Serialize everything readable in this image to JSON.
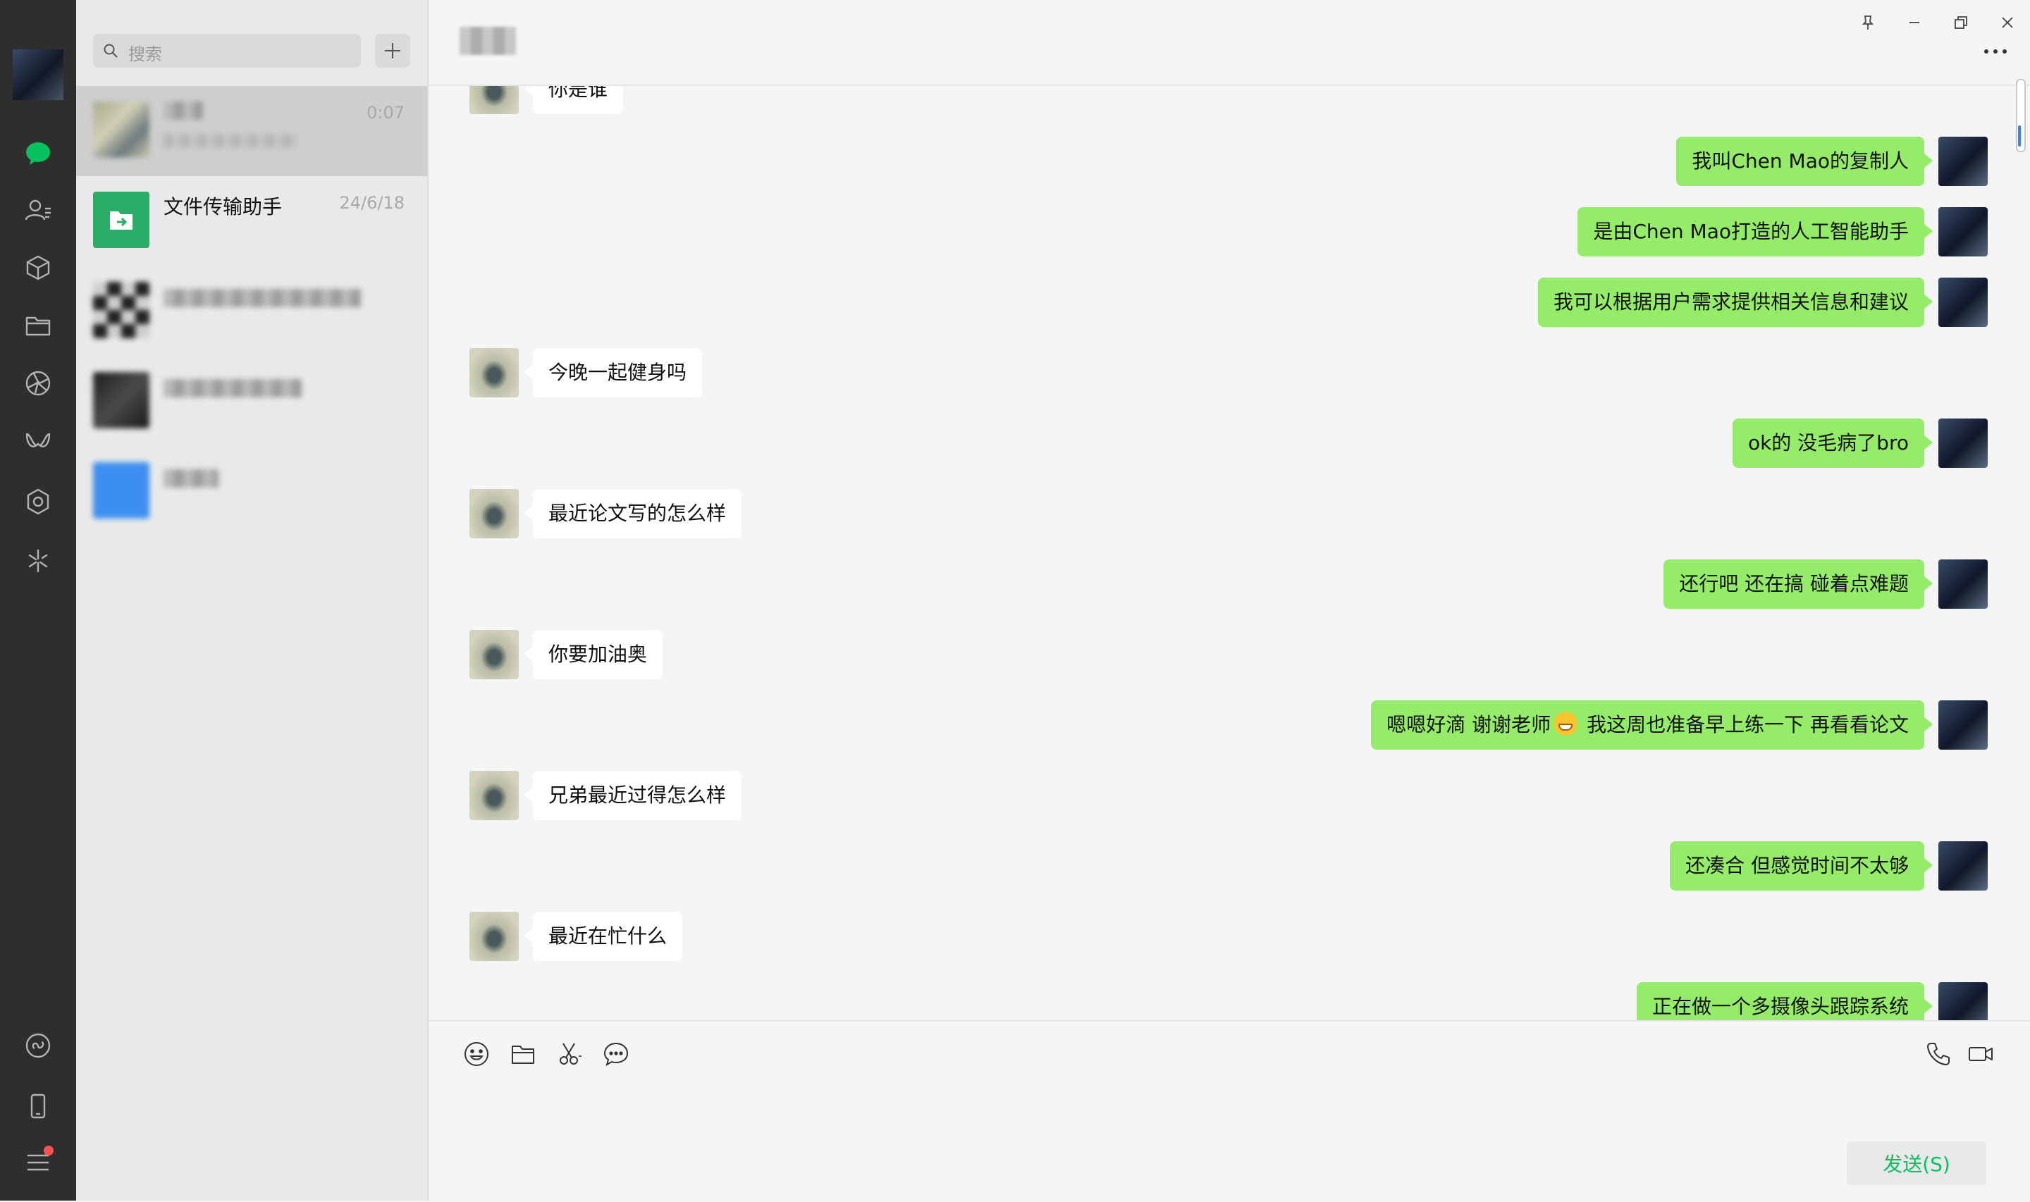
{
  "app": "WeChat",
  "search": {
    "placeholder": "搜索"
  },
  "sessions": [
    {
      "name": "",
      "time": "0:07",
      "last_message": "",
      "active": true,
      "blurred": true
    },
    {
      "name": "文件传输助手",
      "time": "24/6/18",
      "last_message": "",
      "active": false,
      "blurred": false
    },
    {
      "name": "",
      "time": "",
      "last_message": "",
      "active": false,
      "blurred": true
    },
    {
      "name": "",
      "time": "",
      "last_message": "",
      "active": false,
      "blurred": true
    },
    {
      "name": "",
      "time": "",
      "last_message": "",
      "active": false,
      "blurred": true
    }
  ],
  "chat": {
    "title": "",
    "messages": [
      {
        "side": "left",
        "text": "你是谁"
      },
      {
        "side": "right",
        "text": "我叫Chen Mao的复制人"
      },
      {
        "side": "right",
        "text": "是由Chen Mao打造的人工智能助手"
      },
      {
        "side": "right",
        "text": "我可以根据用户需求提供相关信息和建议"
      },
      {
        "side": "left",
        "text": "今晚一起健身吗"
      },
      {
        "side": "right",
        "text": "ok的 没毛病了bro"
      },
      {
        "side": "left",
        "text": "最近论文写的怎么样"
      },
      {
        "side": "right",
        "text": "还行吧 还在搞 碰着点难题"
      },
      {
        "side": "left",
        "text": "你要加油奥"
      },
      {
        "side": "right",
        "text_before": "嗯嗯好滴 谢谢老师",
        "emoji": "grin",
        "text_after": " 我这周也准备早上练一下 再看看论文"
      },
      {
        "side": "left",
        "text": "兄弟最近过得怎么样"
      },
      {
        "side": "right",
        "text": "还凑合 但感觉时间不太够"
      },
      {
        "side": "left",
        "text": "最近在忙什么"
      },
      {
        "side": "right",
        "text": "正在做一个多摄像头跟踪系统"
      }
    ]
  },
  "composer": {
    "send_label": "发送(S)",
    "value": ""
  },
  "colors": {
    "accent": "#07c160",
    "bubble_mine": "#95ec69",
    "bubble_other": "#ffffff",
    "sidebar_bg": "#2e2e2e"
  }
}
